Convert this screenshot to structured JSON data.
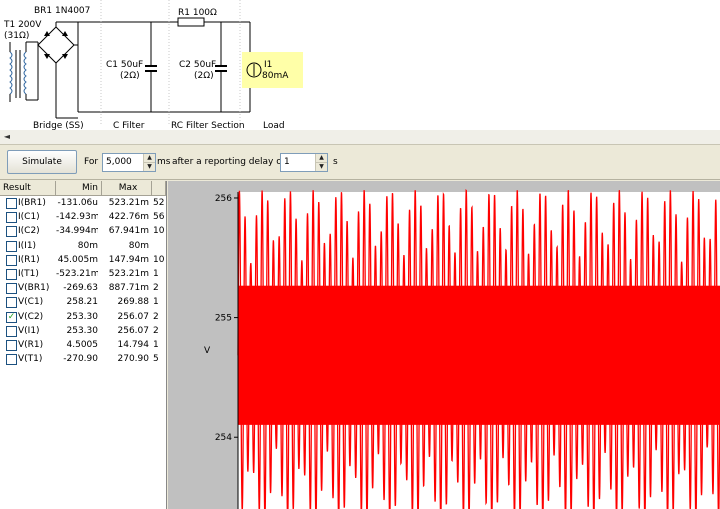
{
  "circuit": {
    "transformer_label": "T1 200V",
    "transformer_resistance": "(31Ω)",
    "bridge_label": "BR1 1N4007",
    "resistor_label": "R1 100Ω",
    "c1_label": "C1 50uF",
    "c1_esr": "(2Ω)",
    "c2_label": "C2 50uF",
    "c2_esr": "(2Ω)",
    "load_label": "I1",
    "load_value": "80mA",
    "section_labels": [
      "Bridge (SS)",
      "C Filter",
      "RC Filter Section",
      "Load"
    ]
  },
  "scrollbar": {
    "left_arrow": "◄"
  },
  "toolbar": {
    "simulate_label": "Simulate",
    "for_label": "For",
    "duration_value": "5,000",
    "duration_unit": "ms",
    "delay_label": "after a reporting delay of",
    "delay_value": "1",
    "delay_unit": "s"
  },
  "results": {
    "headers": [
      "Result",
      "Min",
      "Max",
      ""
    ],
    "rows": [
      {
        "name": "I(BR1)",
        "min": "-131.06u",
        "max": "523.21m",
        "extra": "52",
        "checked": false
      },
      {
        "name": "I(C1)",
        "min": "-142.93m",
        "max": "422.76m",
        "extra": "56",
        "checked": false
      },
      {
        "name": "I(C2)",
        "min": "-34.994m",
        "max": "67.941m",
        "extra": "10",
        "checked": false
      },
      {
        "name": "I(I1)",
        "min": "80m",
        "max": "80m",
        "extra": "",
        "checked": false
      },
      {
        "name": "I(R1)",
        "min": "45.005m",
        "max": "147.94m",
        "extra": "10",
        "checked": false
      },
      {
        "name": "I(T1)",
        "min": "-523.21m",
        "max": "523.21m",
        "extra": "1",
        "checked": false
      },
      {
        "name": "V(BR1)",
        "min": "-269.63",
        "max": "887.71m",
        "extra": "2",
        "checked": false
      },
      {
        "name": "V(C1)",
        "min": "258.21",
        "max": "269.88",
        "extra": "1",
        "checked": false
      },
      {
        "name": "V(C2)",
        "min": "253.30",
        "max": "256.07",
        "extra": "2",
        "checked": true
      },
      {
        "name": "V(I1)",
        "min": "253.30",
        "max": "256.07",
        "extra": "2",
        "checked": false
      },
      {
        "name": "V(R1)",
        "min": "4.5005",
        "max": "14.794",
        "extra": "1",
        "checked": false
      },
      {
        "name": "V(T1)",
        "min": "-270.90",
        "max": "270.90",
        "extra": "5",
        "checked": false
      }
    ]
  },
  "chart_data": {
    "type": "line",
    "title": "",
    "xlabel": "",
    "ylabel": "V",
    "series": [
      {
        "values_min": 253.3,
        "values_max": 256.07
      }
    ],
    "y_ticks": [
      "256",
      "255",
      "254"
    ],
    "y_tick_values": [
      256,
      255,
      254
    ],
    "ylim": [
      253.4,
      256.05
    ],
    "grid": false,
    "line_color": "#ff0000",
    "dense_cycles": 85,
    "envelope_cycles": 19
  }
}
